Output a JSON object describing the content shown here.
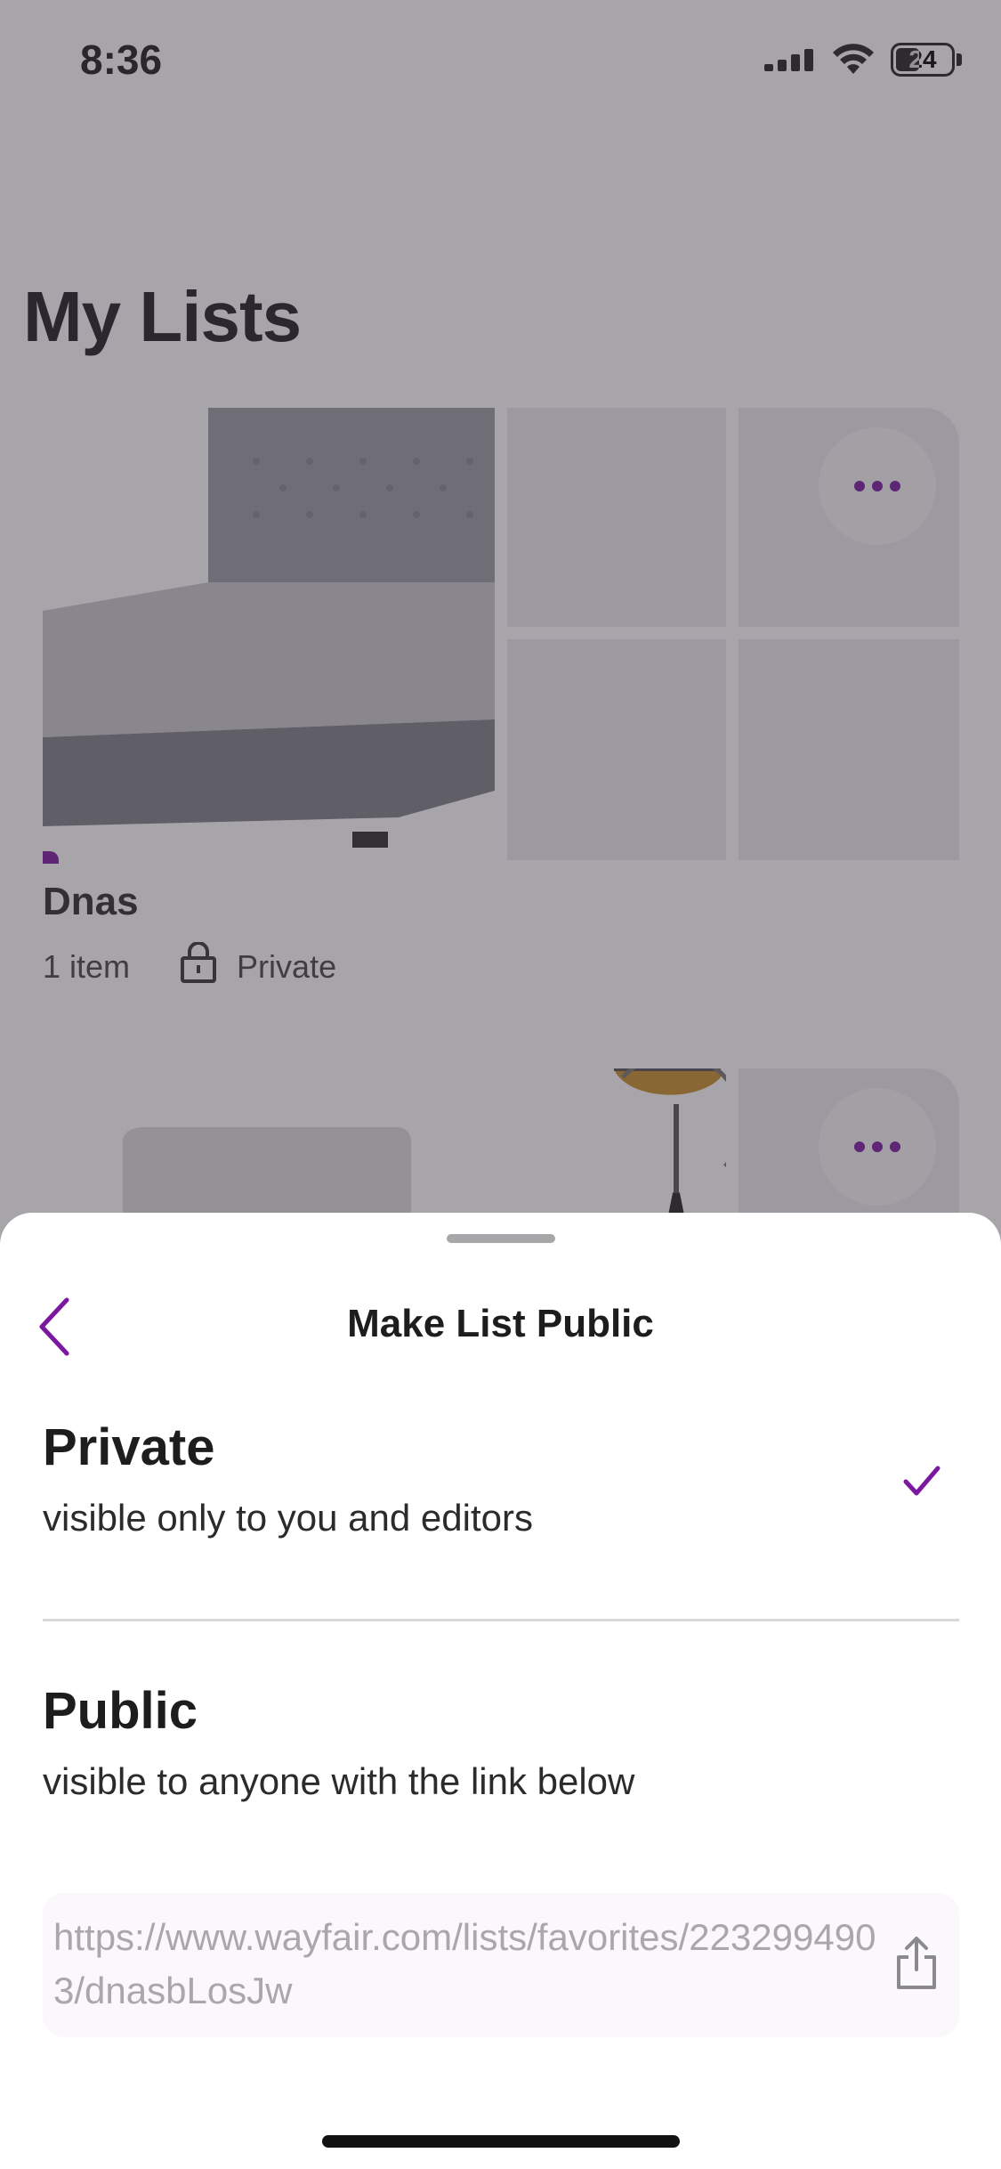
{
  "status_bar": {
    "time": "8:36",
    "battery": "24"
  },
  "page": {
    "title": "My Lists"
  },
  "lists": [
    {
      "name": "Dnas",
      "item_count": "1 item",
      "privacy": "Private"
    }
  ],
  "sheet": {
    "title": "Make List Public",
    "options": [
      {
        "title": "Private",
        "description": "visible only to you and editors",
        "selected": true
      },
      {
        "title": "Public",
        "description": "visible to anyone with the link below",
        "selected": false
      }
    ],
    "link": "https://www.wayfair.com/lists/favorites/2232994903/dnasbLosJw"
  },
  "colors": {
    "accent": "#7b189f",
    "overlay": "#3c3741"
  }
}
